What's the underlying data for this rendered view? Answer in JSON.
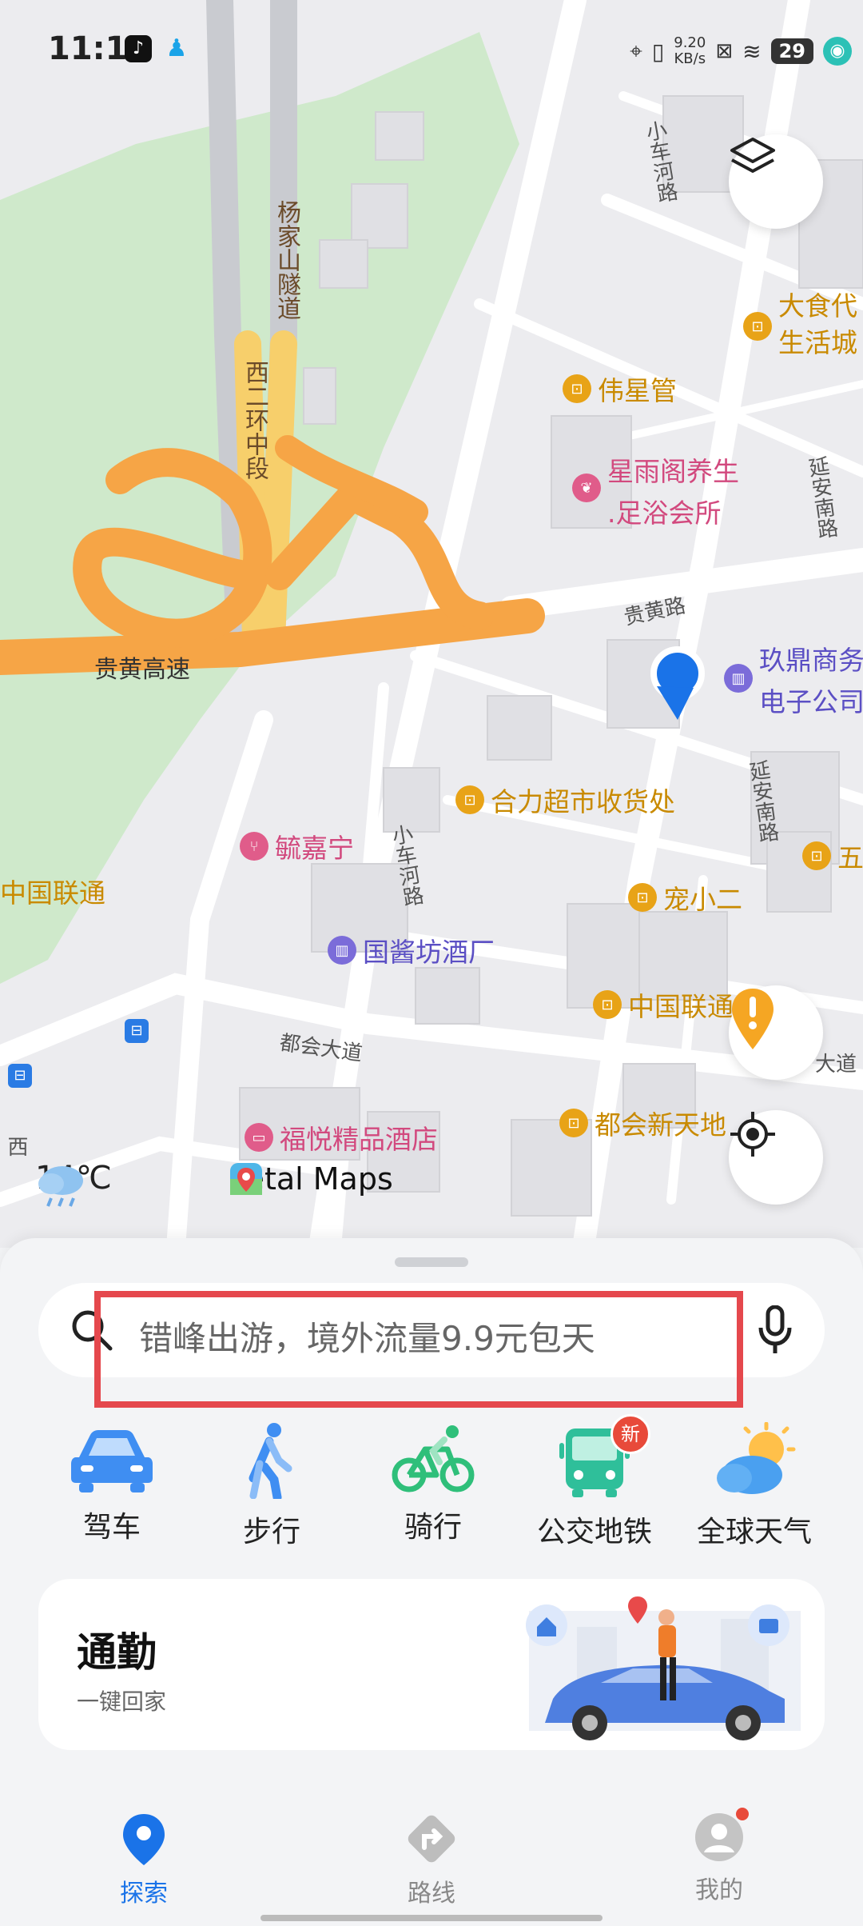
{
  "status_bar": {
    "time": "11:11",
    "net_speed_value": "9.20",
    "net_speed_unit": "KB/s",
    "battery": "29"
  },
  "map": {
    "labels": {
      "tunnel": "杨家山隧道",
      "ring_road": "西二环中段",
      "highway": "贵黄高速",
      "guihuang_road": "贵黄路",
      "xiaochehe_road_top": "小车河路",
      "xiaochehe_road_mid": "小车河路",
      "yanan_south_top": "延安南路",
      "yanan_south_mid": "延安南路",
      "duhui_avenue": "都会大道",
      "duhui_avenue_right": "大道",
      "ring_edge": "西"
    },
    "pois": [
      {
        "name": "大食代生活城",
        "line1": "大食代",
        "line2": "生活城"
      },
      {
        "name": "伟星管"
      },
      {
        "name": "星雨阁养生.足浴会所",
        "line1": "星雨阁养生",
        "line2": ".足浴会所"
      },
      {
        "name": "玖鼎商务电子公司",
        "line1": "玖鼎商务",
        "line2": "电子公司"
      },
      {
        "name": "合力超市收货处"
      },
      {
        "name": "毓嘉宁"
      },
      {
        "name": "中国联通"
      },
      {
        "name": "宠小二"
      },
      {
        "name": "国酱坊酒厂"
      },
      {
        "name": "中国联通"
      },
      {
        "name": "都会新天地"
      },
      {
        "name": "福悦精品酒店"
      },
      {
        "name": "五"
      }
    ],
    "weather_temp": "14℃",
    "brand": "Petal Maps"
  },
  "search": {
    "placeholder": "错峰出游，境外流量9.9元包天"
  },
  "modes": [
    {
      "label": "驾车",
      "icon": "car-icon"
    },
    {
      "label": "步行",
      "icon": "walk-icon"
    },
    {
      "label": "骑行",
      "icon": "bike-icon"
    },
    {
      "label": "公交地铁",
      "icon": "bus-icon",
      "badge": "新"
    },
    {
      "label": "全球天气",
      "icon": "weather-icon"
    }
  ],
  "commute": {
    "title": "通勤",
    "subtitle": "一键回家"
  },
  "nav": [
    {
      "label": "探索",
      "active": true
    },
    {
      "label": "路线",
      "active": false
    },
    {
      "label": "我的",
      "active": false
    }
  ],
  "colors": {
    "accent": "#1a73e8",
    "highway": "#f6a546",
    "ring_road": "#f7cf6b",
    "park": "#cfe9cb",
    "highlight_box": "#e5484d",
    "poi_orange": "#e8a317",
    "poi_pink": "#e05c8a",
    "poi_purple": "#7b6cd9"
  }
}
